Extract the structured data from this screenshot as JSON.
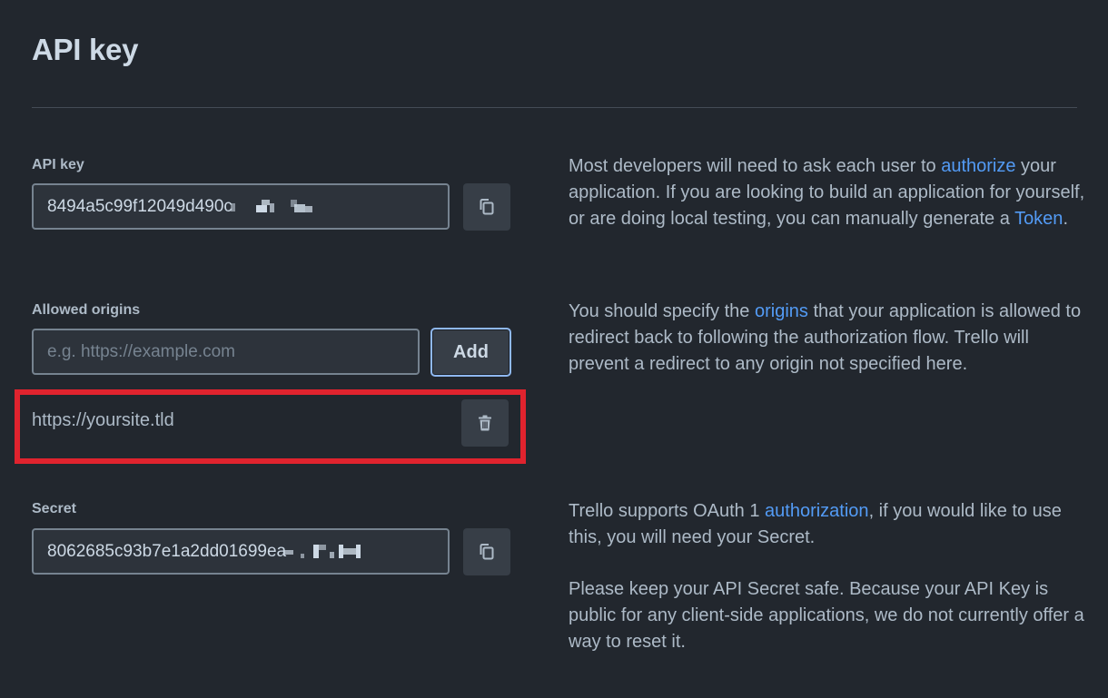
{
  "page": {
    "title": "API key"
  },
  "api_key": {
    "label": "API key",
    "value": "8494a5c99f12049d490c",
    "copy_icon": "copy-icon",
    "description": {
      "part1": "Most developers will need to ask each user to ",
      "link1": "authorize",
      "part2": " your application. If you are looking to build an application for yourself, or are doing local testing, you can manually generate a ",
      "link2": "Token",
      "part3": "."
    }
  },
  "allowed_origins": {
    "label": "Allowed origins",
    "input_placeholder": "e.g. https://example.com",
    "add_label": "Add",
    "items": [
      {
        "url": "https://yoursite.tld",
        "delete_icon": "trash-icon"
      }
    ],
    "description": {
      "part1": "You should specify the ",
      "link1": "origins",
      "part2": " that your application is allowed to redirect back to following the authorization flow. Trello will prevent a redirect to any origin not specified here."
    }
  },
  "secret": {
    "label": "Secret",
    "value": "8062685c93b7e1a2dd01699ea",
    "copy_icon": "copy-icon",
    "description": {
      "part1": "Trello supports OAuth 1 ",
      "link1": "authorization",
      "part2": ", if you would like to use this, you will need your Secret."
    },
    "safety_note": "Please keep your API Secret safe. Because your API Key is public for any client-side applications, we do not currently offer a way to reset it."
  },
  "colors": {
    "background": "#22272e",
    "link": "#539bf5",
    "highlight": "#e0232e"
  }
}
